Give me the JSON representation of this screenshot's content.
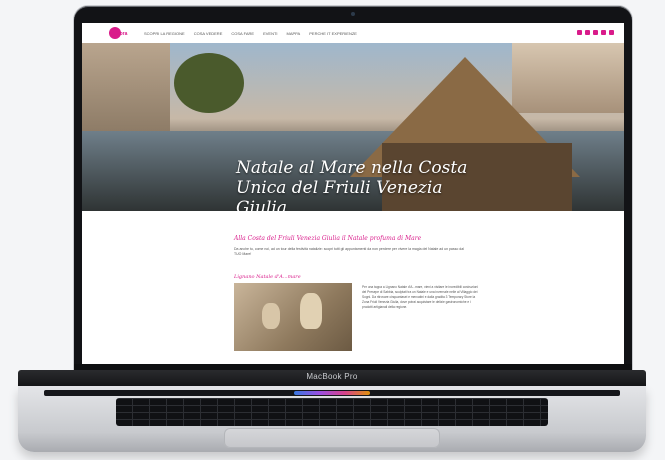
{
  "device": {
    "brand_label": "MacBook Pro"
  },
  "site": {
    "logo_text": "Bora",
    "menu": [
      "SCOPRI LA REGIONE",
      "COSA VEDERE",
      "COSA FARE",
      "EVENTI",
      "MAPPA",
      "PERCHE IT EXPERIENZE"
    ]
  },
  "hero": {
    "title": "Natale al Mare nella Costa Unica del Friuli Venezia Giulia"
  },
  "content": {
    "subheading": "Alla Costa del Friuli Venezia Giulia il Natale profuma di Mare",
    "intro": "Da anche tu, come noi, ad un tour della festività natalizie: scopri tutti gli appuntamenti da non perdere per vivere la magia del Natale ad un passo dal TUO Mare!",
    "section_title": "Lignano Natale d'A...mare",
    "section_text": "Per una tappa a Lignano Natale d'A...mare, vieni a visitare le incredibili costruzioni del Presepe di Sabbia, sculptati tra un Natale e una invernale nelle al Villaggio dei Sogni. Da ritrovare cinquantasei e mercatini e dalla gradita 3 Temporary Store la Zona Friuli Venezia Giulia, dove potrai acquistare le delizie gastronomiche e i prodotti artigianali della regione."
  }
}
